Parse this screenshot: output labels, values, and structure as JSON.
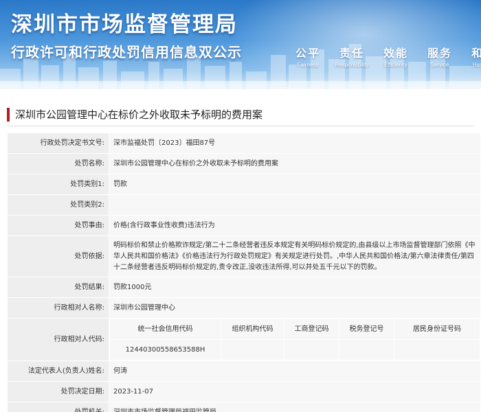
{
  "banner": {
    "title": "深圳市市场监督管理局",
    "subtitle": "行政许可和行政处罚信用信息双公示",
    "slogans": [
      {
        "zh": "公平",
        "en": "Fairness"
      },
      {
        "zh": "责任",
        "en": "Responsibility"
      },
      {
        "zh": "效能",
        "en": "Efficiency"
      },
      {
        "zh": "服务",
        "en": "Service"
      },
      {
        "zh": "和谐",
        "en": "Harmony"
      }
    ]
  },
  "case": {
    "title": "深圳市公园管理中心在标价之外收取未予标明的费用案"
  },
  "fields": {
    "decision_no": {
      "label": "行政处罚决定书文号:",
      "value": "深市监福处罚〔2023〕福田87号"
    },
    "name": {
      "label": "处罚名称:",
      "value": "深圳市公园管理中心在标价之外收取未予标明的费用案"
    },
    "category1": {
      "label": "处罚类别1:",
      "value": "罚款"
    },
    "category2": {
      "label": "处罚类别2:",
      "value": ""
    },
    "reason": {
      "label": "处罚事由:",
      "value": "价格(含行政事业性收费)违法行为"
    },
    "basis": {
      "label": "处罚依据:",
      "value": "明码标价和禁止价格欺诈规定/第二十二条经营者违反本规定有关明码标价规定的,由县级以上市场监督管理部门依照《中华人民共和国价格法》《价格违法行为行政处罚规定》有关规定进行处罚。,中华人民共和国价格法/第六章法律责任/第四十二条经营者违反明码标价规定的,责令改正,没收违法所得,可以并处五千元以下的罚款。"
    },
    "result": {
      "label": "处罚结果:",
      "value": "罚款1000元"
    },
    "party": {
      "label": "行政相对人名称:",
      "value": "深圳市公园管理中心"
    },
    "party_codes": {
      "label": "行政相对人代码:",
      "headers": [
        "统一社会信用代码",
        "组织机构代码",
        "工商登记码",
        "税务登记号",
        "居民身份证号码"
      ],
      "values": [
        "12440300558653588H",
        "",
        "",
        "",
        ""
      ]
    },
    "legal_rep": {
      "label": "法定代表人(负责人)姓名:",
      "value": "何涛"
    },
    "decision_date": {
      "label": "处罚决定日期:",
      "value": "2023-11-07"
    },
    "authority": {
      "label": "处罚机关:",
      "value": "深圳市市场监督管理局福田监管局"
    }
  },
  "colors": {
    "accent_marker": "#b01f24",
    "label_bg": "#eeeeee",
    "value_bg": "#f7f7f7",
    "banner_blue": "#2a78c8"
  }
}
